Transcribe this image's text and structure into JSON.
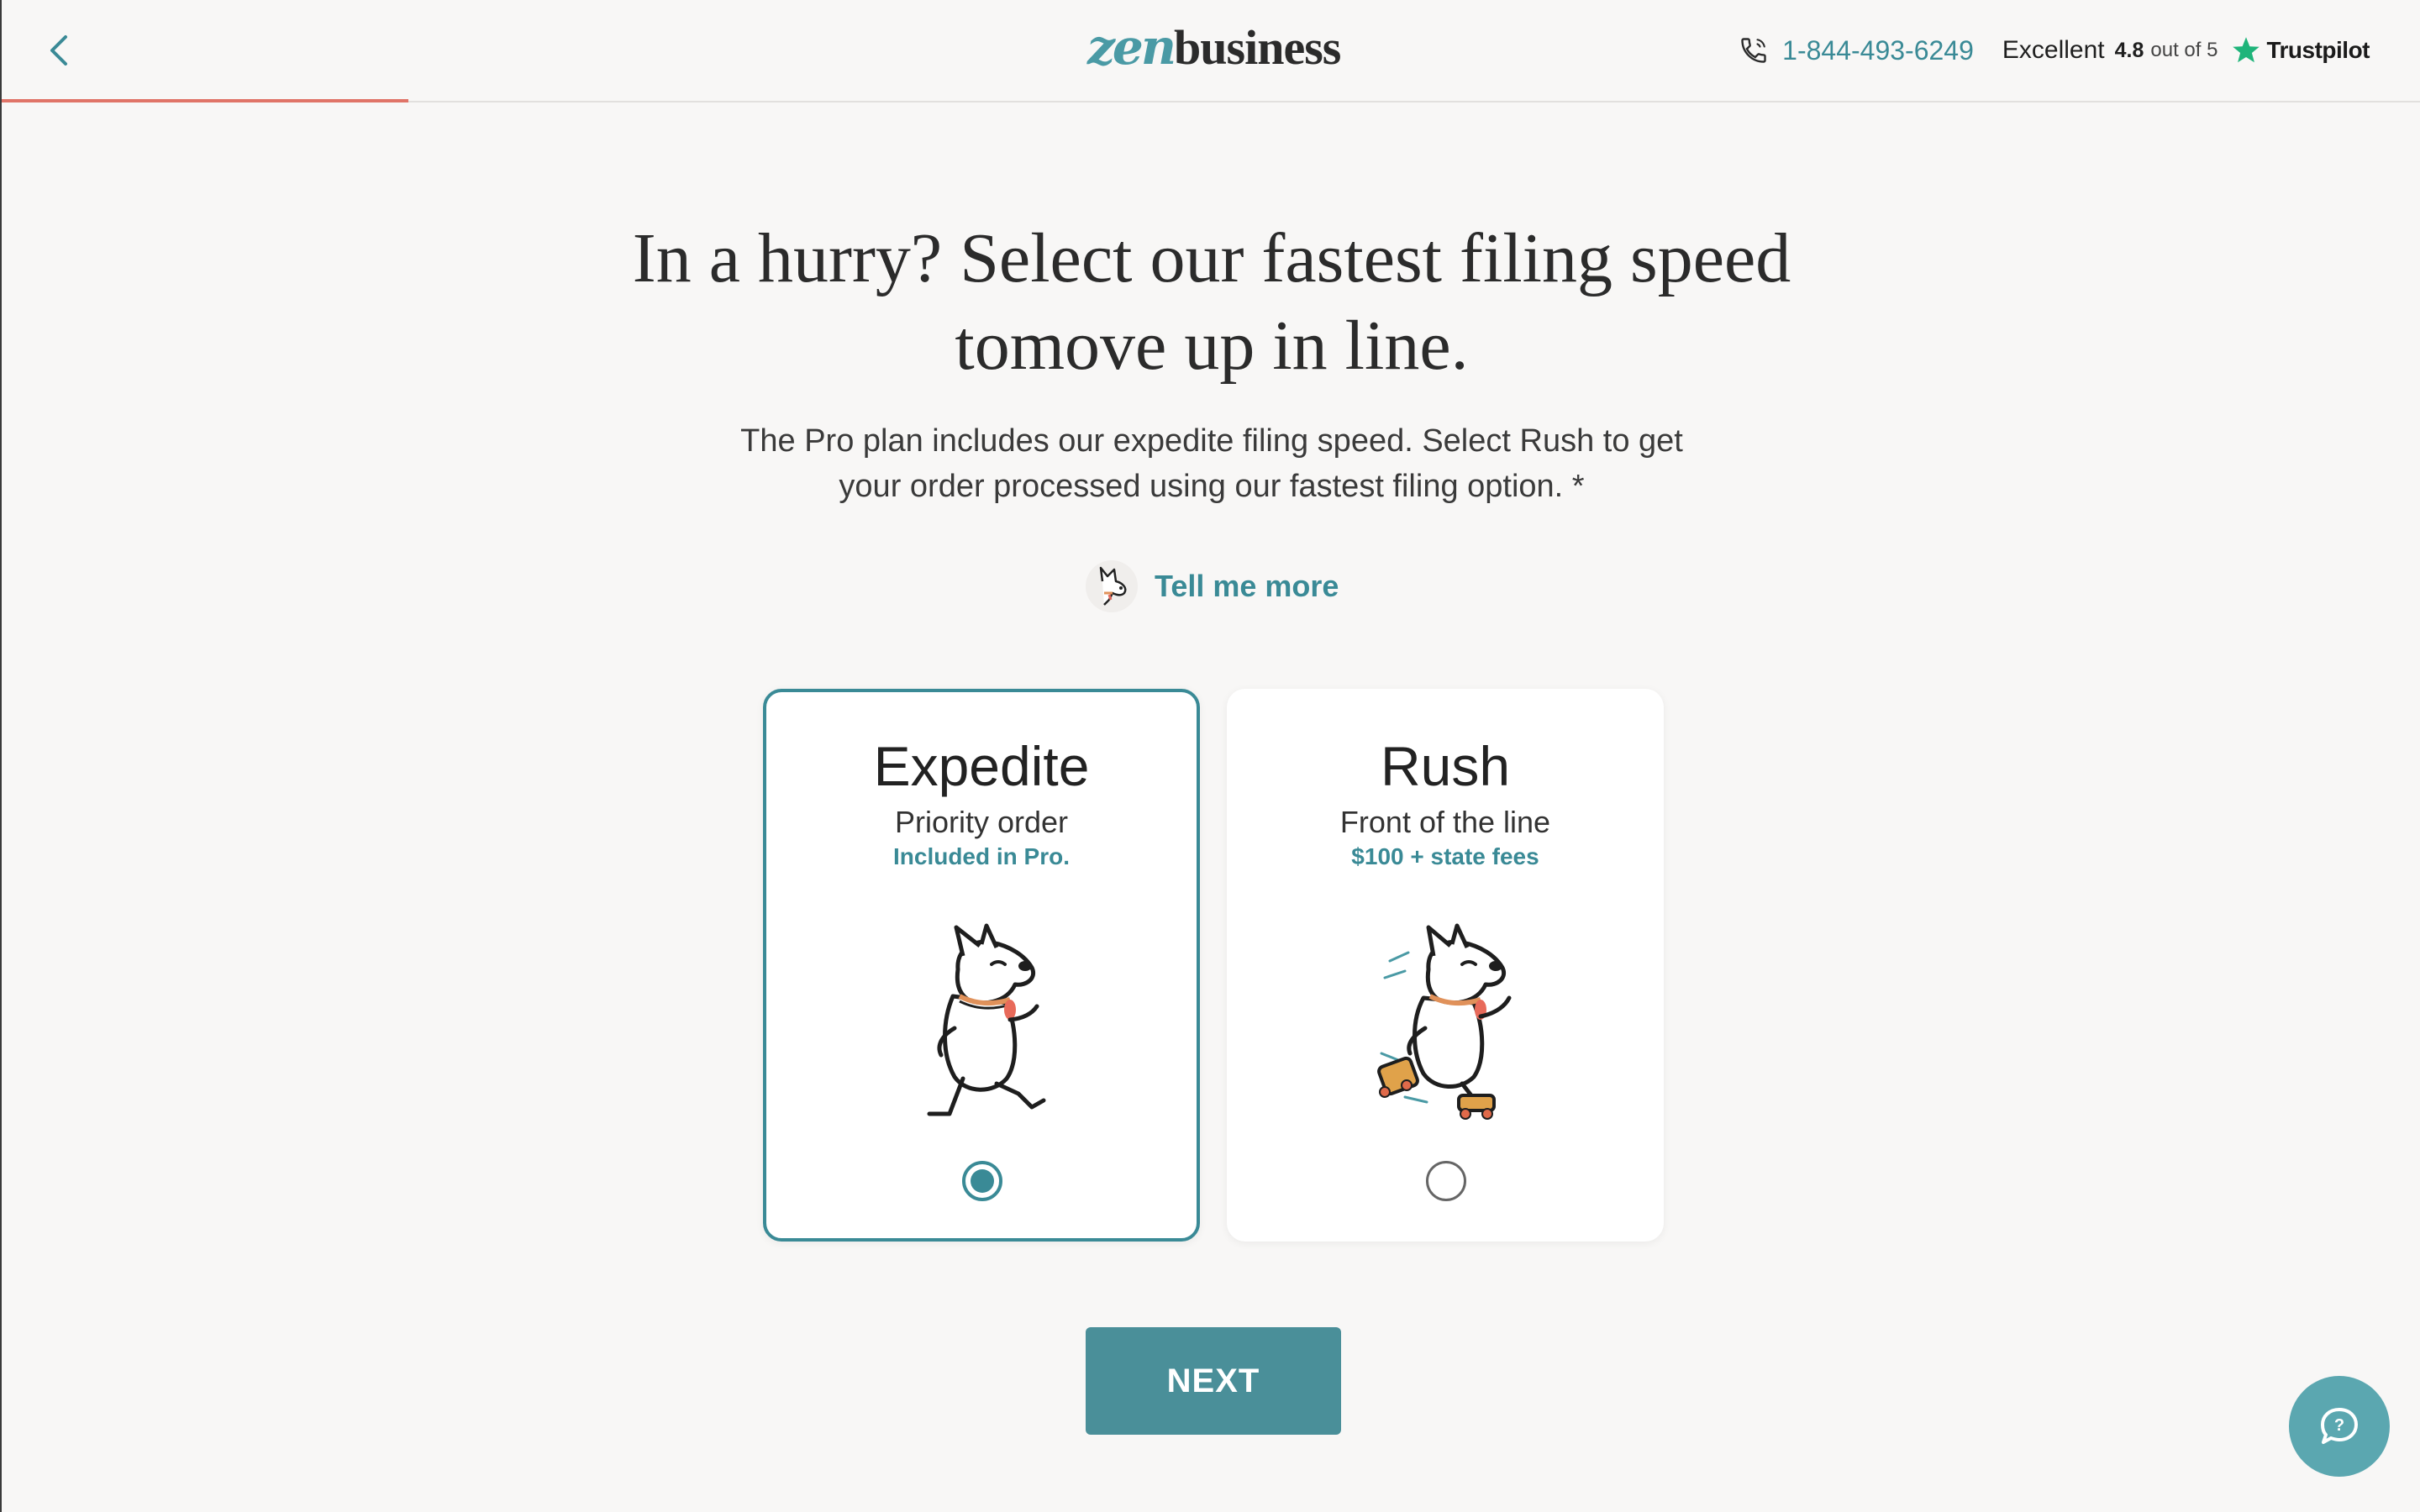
{
  "header": {
    "logo_prefix": "zen",
    "logo_suffix": "business",
    "phone": "1-844-493-6249",
    "rating_word": "Excellent",
    "rating_score": "4.8",
    "rating_suffix": "out of 5",
    "rating_source": "Trustpilot"
  },
  "progress": {
    "fraction": 0.168
  },
  "main": {
    "headline": "In a hurry? Select our fastest filing speed tomove up in line.",
    "subtext": "The Pro plan includes our expedite filing speed. Select Rush to get your order processed using our fastest filing option. *",
    "tell_more": "Tell me more"
  },
  "options": [
    {
      "title": "Expedite",
      "subtitle": "Priority order",
      "note": "Included in Pro.",
      "selected": true
    },
    {
      "title": "Rush",
      "subtitle": "Front of the line",
      "note": "$100 + state fees",
      "selected": false
    }
  ],
  "next_label": "NEXT",
  "icons": {
    "back": "chevron-left-icon",
    "phone": "phone-icon",
    "star": "star-icon",
    "chat": "help-chat-icon",
    "mascot": "dog-mascot"
  },
  "colors": {
    "accent": "#3a8a96",
    "progress": "#e07468",
    "button": "#4a8f99",
    "trustpilot_star": "#1fb47a"
  }
}
